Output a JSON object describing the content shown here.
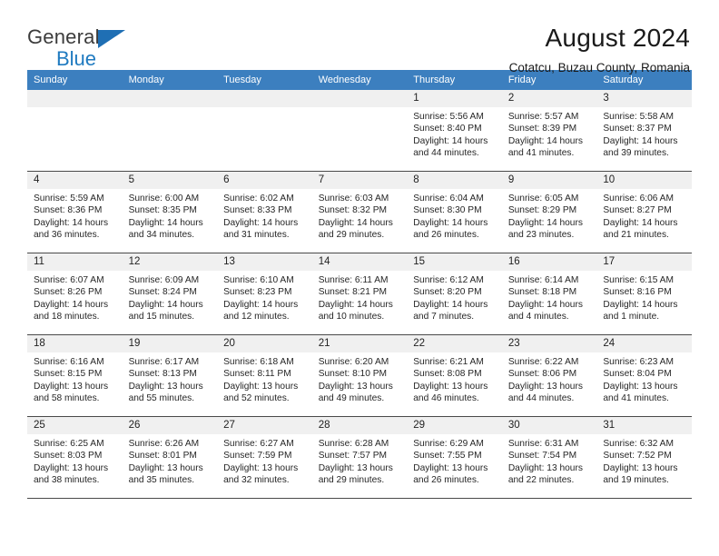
{
  "brand": {
    "line1": "General",
    "line2": "Blue",
    "triangle_color": "#1f7ac0"
  },
  "header": {
    "title": "August 2024",
    "subtitle": "Cotatcu, Buzau County, Romania"
  },
  "theme": {
    "header_row_bg": "#3c7fbf",
    "header_row_text": "#ffffff",
    "daynum_bg": "#f0f0f0",
    "grid_line": "#4a4a4a"
  },
  "weekdays": [
    "Sunday",
    "Monday",
    "Tuesday",
    "Wednesday",
    "Thursday",
    "Friday",
    "Saturday"
  ],
  "labels": {
    "sunrise_prefix": "Sunrise: ",
    "sunset_prefix": "Sunset: ",
    "daylight_prefix": "Daylight: "
  },
  "weeks": [
    [
      {
        "empty": true
      },
      {
        "empty": true
      },
      {
        "empty": true
      },
      {
        "empty": true
      },
      {
        "day": "1",
        "sunrise": "Sunrise: 5:56 AM",
        "sunset": "Sunset: 8:40 PM",
        "daylight1": "Daylight: 14 hours",
        "daylight2": "and 44 minutes."
      },
      {
        "day": "2",
        "sunrise": "Sunrise: 5:57 AM",
        "sunset": "Sunset: 8:39 PM",
        "daylight1": "Daylight: 14 hours",
        "daylight2": "and 41 minutes."
      },
      {
        "day": "3",
        "sunrise": "Sunrise: 5:58 AM",
        "sunset": "Sunset: 8:37 PM",
        "daylight1": "Daylight: 14 hours",
        "daylight2": "and 39 minutes."
      }
    ],
    [
      {
        "day": "4",
        "sunrise": "Sunrise: 5:59 AM",
        "sunset": "Sunset: 8:36 PM",
        "daylight1": "Daylight: 14 hours",
        "daylight2": "and 36 minutes."
      },
      {
        "day": "5",
        "sunrise": "Sunrise: 6:00 AM",
        "sunset": "Sunset: 8:35 PM",
        "daylight1": "Daylight: 14 hours",
        "daylight2": "and 34 minutes."
      },
      {
        "day": "6",
        "sunrise": "Sunrise: 6:02 AM",
        "sunset": "Sunset: 8:33 PM",
        "daylight1": "Daylight: 14 hours",
        "daylight2": "and 31 minutes."
      },
      {
        "day": "7",
        "sunrise": "Sunrise: 6:03 AM",
        "sunset": "Sunset: 8:32 PM",
        "daylight1": "Daylight: 14 hours",
        "daylight2": "and 29 minutes."
      },
      {
        "day": "8",
        "sunrise": "Sunrise: 6:04 AM",
        "sunset": "Sunset: 8:30 PM",
        "daylight1": "Daylight: 14 hours",
        "daylight2": "and 26 minutes."
      },
      {
        "day": "9",
        "sunrise": "Sunrise: 6:05 AM",
        "sunset": "Sunset: 8:29 PM",
        "daylight1": "Daylight: 14 hours",
        "daylight2": "and 23 minutes."
      },
      {
        "day": "10",
        "sunrise": "Sunrise: 6:06 AM",
        "sunset": "Sunset: 8:27 PM",
        "daylight1": "Daylight: 14 hours",
        "daylight2": "and 21 minutes."
      }
    ],
    [
      {
        "day": "11",
        "sunrise": "Sunrise: 6:07 AM",
        "sunset": "Sunset: 8:26 PM",
        "daylight1": "Daylight: 14 hours",
        "daylight2": "and 18 minutes."
      },
      {
        "day": "12",
        "sunrise": "Sunrise: 6:09 AM",
        "sunset": "Sunset: 8:24 PM",
        "daylight1": "Daylight: 14 hours",
        "daylight2": "and 15 minutes."
      },
      {
        "day": "13",
        "sunrise": "Sunrise: 6:10 AM",
        "sunset": "Sunset: 8:23 PM",
        "daylight1": "Daylight: 14 hours",
        "daylight2": "and 12 minutes."
      },
      {
        "day": "14",
        "sunrise": "Sunrise: 6:11 AM",
        "sunset": "Sunset: 8:21 PM",
        "daylight1": "Daylight: 14 hours",
        "daylight2": "and 10 minutes."
      },
      {
        "day": "15",
        "sunrise": "Sunrise: 6:12 AM",
        "sunset": "Sunset: 8:20 PM",
        "daylight1": "Daylight: 14 hours",
        "daylight2": "and 7 minutes."
      },
      {
        "day": "16",
        "sunrise": "Sunrise: 6:14 AM",
        "sunset": "Sunset: 8:18 PM",
        "daylight1": "Daylight: 14 hours",
        "daylight2": "and 4 minutes."
      },
      {
        "day": "17",
        "sunrise": "Sunrise: 6:15 AM",
        "sunset": "Sunset: 8:16 PM",
        "daylight1": "Daylight: 14 hours",
        "daylight2": "and 1 minute."
      }
    ],
    [
      {
        "day": "18",
        "sunrise": "Sunrise: 6:16 AM",
        "sunset": "Sunset: 8:15 PM",
        "daylight1": "Daylight: 13 hours",
        "daylight2": "and 58 minutes."
      },
      {
        "day": "19",
        "sunrise": "Sunrise: 6:17 AM",
        "sunset": "Sunset: 8:13 PM",
        "daylight1": "Daylight: 13 hours",
        "daylight2": "and 55 minutes."
      },
      {
        "day": "20",
        "sunrise": "Sunrise: 6:18 AM",
        "sunset": "Sunset: 8:11 PM",
        "daylight1": "Daylight: 13 hours",
        "daylight2": "and 52 minutes."
      },
      {
        "day": "21",
        "sunrise": "Sunrise: 6:20 AM",
        "sunset": "Sunset: 8:10 PM",
        "daylight1": "Daylight: 13 hours",
        "daylight2": "and 49 minutes."
      },
      {
        "day": "22",
        "sunrise": "Sunrise: 6:21 AM",
        "sunset": "Sunset: 8:08 PM",
        "daylight1": "Daylight: 13 hours",
        "daylight2": "and 46 minutes."
      },
      {
        "day": "23",
        "sunrise": "Sunrise: 6:22 AM",
        "sunset": "Sunset: 8:06 PM",
        "daylight1": "Daylight: 13 hours",
        "daylight2": "and 44 minutes."
      },
      {
        "day": "24",
        "sunrise": "Sunrise: 6:23 AM",
        "sunset": "Sunset: 8:04 PM",
        "daylight1": "Daylight: 13 hours",
        "daylight2": "and 41 minutes."
      }
    ],
    [
      {
        "day": "25",
        "sunrise": "Sunrise: 6:25 AM",
        "sunset": "Sunset: 8:03 PM",
        "daylight1": "Daylight: 13 hours",
        "daylight2": "and 38 minutes."
      },
      {
        "day": "26",
        "sunrise": "Sunrise: 6:26 AM",
        "sunset": "Sunset: 8:01 PM",
        "daylight1": "Daylight: 13 hours",
        "daylight2": "and 35 minutes."
      },
      {
        "day": "27",
        "sunrise": "Sunrise: 6:27 AM",
        "sunset": "Sunset: 7:59 PM",
        "daylight1": "Daylight: 13 hours",
        "daylight2": "and 32 minutes."
      },
      {
        "day": "28",
        "sunrise": "Sunrise: 6:28 AM",
        "sunset": "Sunset: 7:57 PM",
        "daylight1": "Daylight: 13 hours",
        "daylight2": "and 29 minutes."
      },
      {
        "day": "29",
        "sunrise": "Sunrise: 6:29 AM",
        "sunset": "Sunset: 7:55 PM",
        "daylight1": "Daylight: 13 hours",
        "daylight2": "and 26 minutes."
      },
      {
        "day": "30",
        "sunrise": "Sunrise: 6:31 AM",
        "sunset": "Sunset: 7:54 PM",
        "daylight1": "Daylight: 13 hours",
        "daylight2": "and 22 minutes."
      },
      {
        "day": "31",
        "sunrise": "Sunrise: 6:32 AM",
        "sunset": "Sunset: 7:52 PM",
        "daylight1": "Daylight: 13 hours",
        "daylight2": "and 19 minutes."
      }
    ]
  ]
}
